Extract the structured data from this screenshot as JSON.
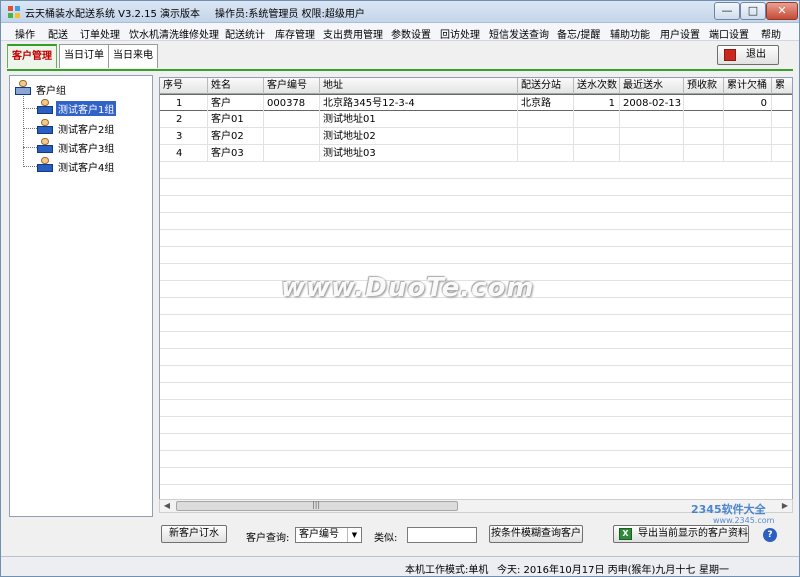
{
  "window": {
    "title": "云天桶装水配送系统 V3.2.15 演示版本",
    "operator_info": "操作员:系统管理员  权限:超级用户",
    "minimize_label": "—",
    "maximize_label": "□",
    "close_label": "✕"
  },
  "menu": [
    "操作",
    "配送",
    "订单处理",
    "饮水机清洗维修处理",
    "配送统计",
    "库存管理",
    "支出费用管理",
    "参数设置",
    "回访处理",
    "短信发送查询",
    "备忘/提醒",
    "辅助功能",
    "用户设置",
    "端口设置",
    "帮助"
  ],
  "tabs": [
    "客户管理",
    "当日订单",
    "当日来电"
  ],
  "exit_label": "退出",
  "tree": {
    "root": "客户组",
    "children": [
      "测试客户1组",
      "测试客户2组",
      "测试客户3组",
      "测试客户4组"
    ],
    "selected_index": 0
  },
  "grid": {
    "columns": [
      "序号",
      "姓名",
      "客户编号",
      "地址",
      "配送分站",
      "送水次数",
      "最近送水",
      "预收款",
      "累计欠桶",
      "累"
    ],
    "rows": [
      [
        "1",
        "客户",
        "000378",
        "北京路345号12-3-4",
        "北京路",
        "1",
        "2008-02-13",
        "",
        "0",
        ""
      ],
      [
        "2",
        "客户01",
        "",
        "测试地址01",
        "",
        "",
        "",
        "",
        "",
        ""
      ],
      [
        "3",
        "客户02",
        "",
        "测试地址02",
        "",
        "",
        "",
        "",
        "",
        ""
      ],
      [
        "4",
        "客户03",
        "",
        "测试地址03",
        "",
        "",
        "",
        "",
        "",
        ""
      ]
    ]
  },
  "toolbar": {
    "new_order_label": "新客户订水",
    "query_label": "客户查询:",
    "query_field_value": "客户编号",
    "like_label": "类似:",
    "like_value": "",
    "fuzzy_search_label": "按条件模糊查询客户",
    "export_label": "导出当前显示的客户资料",
    "help_label": "?"
  },
  "status": {
    "mode": "本机工作模式:单机",
    "today": "今天: 2016年10月17日  丙申(猴年)九月十七",
    "weekday": "星期一"
  },
  "watermark": "www.DuoTe.com",
  "corner_brand": "2345软件大全",
  "corner_brand_sub": "www.2345.com",
  "icons": {
    "app": "app-icon",
    "exit": "exit-icon",
    "export": "excel-icon",
    "help": "help-icon",
    "tree_node": "user-group-icon"
  },
  "colors": {
    "active_tab_text": "#c00000",
    "tab_accent": "#39a02a",
    "selection": "#3162c8"
  }
}
